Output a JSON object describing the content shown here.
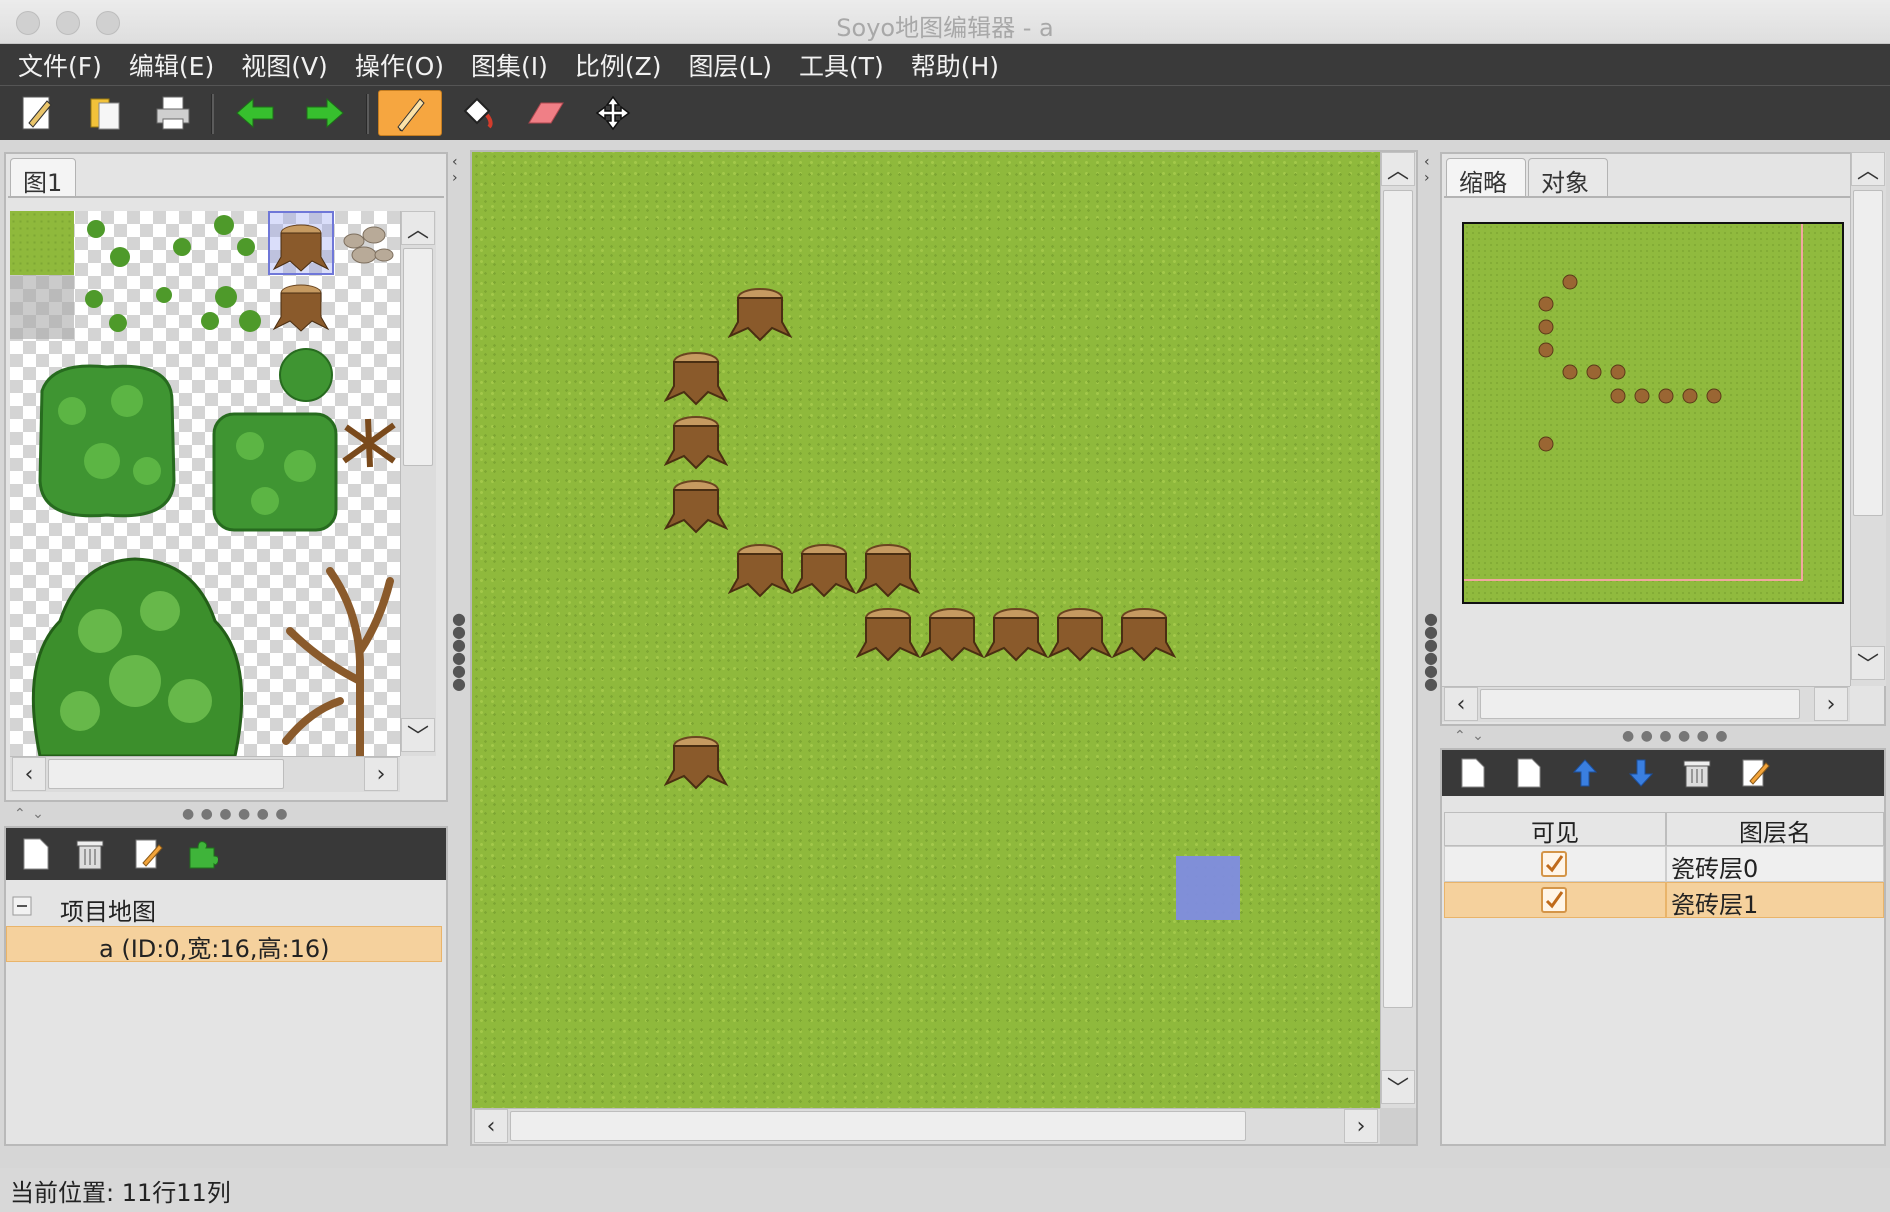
{
  "window": {
    "title": "Soyo地图编辑器 - a"
  },
  "menu": {
    "items": [
      "文件(F)",
      "编辑(E)",
      "视图(V)",
      "操作(O)",
      "图集(I)",
      "比例(Z)",
      "图层(L)",
      "工具(T)",
      "帮助(H)"
    ]
  },
  "toolbar": {
    "tools": [
      "new-file-icon",
      "open-folder-icon",
      "print-icon",
      "undo-arrow-icon",
      "redo-arrow-icon",
      "pencil-icon",
      "paint-bucket-icon",
      "eraser-icon",
      "move-icon"
    ],
    "active_tool": "pencil-icon"
  },
  "tileset_panel": {
    "tab_label": "图1"
  },
  "project_panel": {
    "root_label": "项目地图",
    "map_item": "a (ID:0,宽:16,高:16)",
    "toolbar_icons": [
      "new-file-icon",
      "trash-icon",
      "edit-icon",
      "puzzle-icon"
    ]
  },
  "right_panel": {
    "tabs": [
      "缩略",
      "对象"
    ],
    "selected_tab": "缩略"
  },
  "layers": {
    "toolbar_icons": [
      "new-file-icon",
      "copy-file-icon",
      "move-up-icon",
      "move-down-icon",
      "trash-icon",
      "edit-icon"
    ],
    "headers": {
      "visible": "可见",
      "name": "图层名"
    },
    "rows": [
      {
        "visible": true,
        "name": "瓷砖层0",
        "selected": false
      },
      {
        "visible": true,
        "name": "瓷砖层1",
        "selected": true
      }
    ]
  },
  "status": {
    "text": "当前位置: 11行11列"
  },
  "colors": {
    "accent": "#f6a640",
    "selection": "#f5d19d",
    "grass": "#8fb93c",
    "cursor": "#7f8ce0"
  }
}
